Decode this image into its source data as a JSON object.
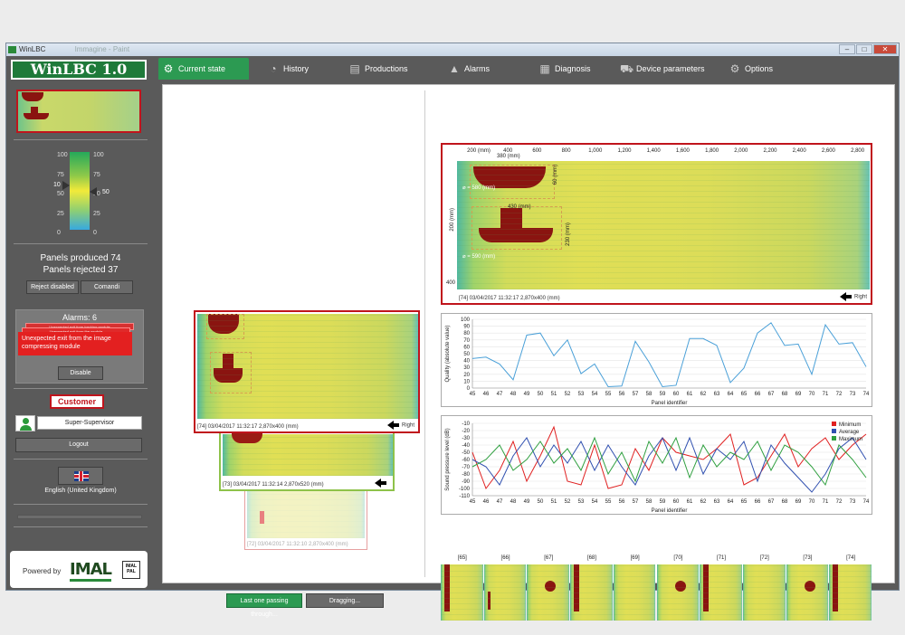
{
  "window": {
    "title": "WinLBC",
    "faded_title": "Immagine - Paint"
  },
  "sidebar": {
    "logo": "WinLBC 1.0",
    "scale": {
      "left_ticks": [
        "100",
        "75",
        "50",
        "25",
        "0"
      ],
      "right_ticks": [
        "100",
        "75",
        "50",
        "25",
        "0"
      ],
      "left_marker": "10",
      "right_marker": "50"
    },
    "produced_label": "Panels produced",
    "produced_value": "74",
    "rejected_label": "Panels rejected",
    "rejected_value": "37",
    "reject_button": "Reject disabled",
    "comandi_button": "Comandi",
    "alarms_title": "Alarms: 6",
    "alarm_bg1": "Unexpected exit from tracking module",
    "alarm_bg2": "Unexpected exit from the module",
    "alarm_main": "Unexpected exit from the image compressing module",
    "disable_button": "Disable",
    "customer_label": "Customer",
    "user_name": "Super-Supervisor",
    "logout_button": "Logout",
    "language": "English (United Kingdom)",
    "powered_by": "Powered by",
    "brand": "IMAL",
    "brand_sub": "IMAL PAL"
  },
  "tabs": [
    {
      "label": "Current state",
      "icon": "gear-icon",
      "glyph": "⚙"
    },
    {
      "label": "History",
      "icon": "pie-chart-icon",
      "glyph": "◔"
    },
    {
      "label": "Productions",
      "icon": "document-icon",
      "glyph": "▤"
    },
    {
      "label": "Alarms",
      "icon": "warning-icon",
      "glyph": "▲"
    },
    {
      "label": "Diagnosis",
      "icon": "diagnosis-icon",
      "glyph": "▦"
    },
    {
      "label": "Device parameters",
      "icon": "cart-icon",
      "glyph": "⛟"
    },
    {
      "label": "Options",
      "icon": "settings-icon",
      "glyph": "⚙"
    }
  ],
  "panels": {
    "main_caption": "[74]   03/04/2017 11:32:17    2,870x400 (mm)",
    "main_direction": "Right",
    "second_caption": "[73]   03/04/2017 11:32:14    2,870x520 (mm)",
    "third_caption": "[72]   03/04/2017 11:32:10    2,870x400 (mm)"
  },
  "buttons": {
    "last_one": "Last one passing through...",
    "dragging": "Dragging..."
  },
  "top_chart": {
    "x_ticks": [
      "200 (mm)",
      "400",
      "600",
      "800",
      "1,000",
      "1,200",
      "1,400",
      "1,600",
      "1,800",
      "2,000",
      "2,200",
      "2,400",
      "2,600",
      "2,800"
    ],
    "y_ticks": [
      "200 (mm)",
      "400"
    ],
    "caption": "[74]   03/04/2017 11:32:17    2,870x400 (mm)",
    "direction": "Right",
    "annotations": {
      "d1": "380 (mm)",
      "d2": "⌀ = 580 (mm)",
      "d3": "430 (mm)",
      "d4": "⌀ = 590 (mm)",
      "d5": "230 (mm)",
      "d6": "60 (mm)"
    }
  },
  "chart_data": [
    {
      "type": "line",
      "title": "",
      "xlabel": "Panel identifier",
      "ylabel": "Quality (absolute value)",
      "ylim": [
        0,
        100
      ],
      "y_ticks": [
        0,
        10,
        20,
        30,
        40,
        50,
        60,
        70,
        80,
        90,
        100
      ],
      "categories": [
        "45",
        "46",
        "47",
        "48",
        "49",
        "50",
        "51",
        "52",
        "53",
        "54",
        "55",
        "56",
        "57",
        "58",
        "59",
        "60",
        "61",
        "62",
        "63",
        "64",
        "65",
        "66",
        "67",
        "68",
        "69",
        "70",
        "71",
        "72",
        "73",
        "74"
      ],
      "series": [
        {
          "color": "#4aa0d8",
          "values": [
            43,
            45,
            35,
            12,
            77,
            80,
            47,
            70,
            21,
            35,
            2,
            3,
            68,
            38,
            2,
            4,
            72,
            72,
            62,
            8,
            29,
            80,
            95,
            62,
            64,
            20,
            92,
            64,
            66,
            31
          ]
        }
      ]
    },
    {
      "type": "line",
      "title": "",
      "xlabel": "Panel identifier",
      "ylabel": "Sound pressure level (dB)",
      "ylim": [
        -110,
        -10
      ],
      "y_ticks": [
        -10,
        -20,
        -30,
        -40,
        -50,
        -60,
        -70,
        -80,
        -90,
        -100,
        -110
      ],
      "categories": [
        "45",
        "46",
        "47",
        "48",
        "49",
        "50",
        "51",
        "52",
        "53",
        "54",
        "55",
        "56",
        "57",
        "58",
        "59",
        "60",
        "61",
        "62",
        "63",
        "64",
        "65",
        "66",
        "67",
        "68",
        "69",
        "70",
        "71",
        "72",
        "73",
        "74"
      ],
      "legend_position": "top-right",
      "series": [
        {
          "name": "Minimum",
          "color": "#e02020",
          "values": [
            -50,
            -100,
            -75,
            -35,
            -90,
            -55,
            -15,
            -90,
            -95,
            -40,
            -100,
            -95,
            -45,
            -75,
            -30,
            -50,
            -55,
            -60,
            -45,
            -25,
            -95,
            -85,
            -55,
            -25,
            -70,
            -45,
            -30,
            -60,
            -40,
            -25
          ]
        },
        {
          "name": "Average",
          "color": "#3050b0",
          "values": [
            -60,
            -70,
            -95,
            -55,
            -30,
            -70,
            -40,
            -65,
            -35,
            -75,
            -40,
            -70,
            -95,
            -55,
            -30,
            -75,
            -30,
            -80,
            -45,
            -60,
            -35,
            -90,
            -40,
            -65,
            -85,
            -105,
            -80,
            -45,
            -30,
            -60
          ]
        },
        {
          "name": "Maximum",
          "color": "#30a040",
          "values": [
            -70,
            -60,
            -40,
            -75,
            -60,
            -35,
            -65,
            -45,
            -75,
            -30,
            -80,
            -50,
            -90,
            -35,
            -65,
            -30,
            -85,
            -40,
            -70,
            -50,
            -60,
            -35,
            -75,
            -40,
            -50,
            -70,
            -95,
            -40,
            -60,
            -85
          ]
        }
      ]
    }
  ],
  "strip": {
    "labels": [
      "[65]",
      "[66]",
      "[67]",
      "[68]",
      "[69]",
      "[70]",
      "[71]",
      "[72]",
      "[73]",
      "[74]"
    ]
  },
  "colors": {
    "accent": "#2c9a52",
    "reject": "#c0141c",
    "defect": "#8a1410",
    "alarm": "#e32020"
  }
}
